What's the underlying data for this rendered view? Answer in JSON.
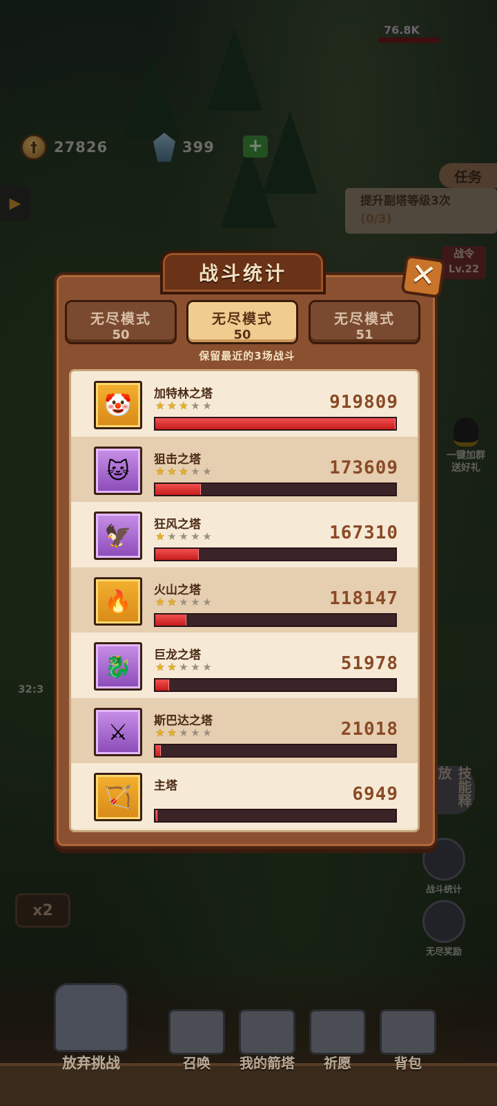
{
  "hud": {
    "gold": "27826",
    "gems": "399",
    "add_label": "+",
    "boss_hp": "76.8K",
    "quest_tab": "任务",
    "quest_text": "提升副塔等级3次",
    "quest_progress": "(0/3)",
    "battle_pass": "战令",
    "battle_pass_level": "Lv.22",
    "qq_group": "一键加群",
    "qq_gift": "送好礼",
    "stats_button": "战斗统计",
    "endless_reward": "无尽奖励",
    "skill_release": "技能释放",
    "speed": "x2",
    "timer": "32:3"
  },
  "bottom_nav": {
    "give_up": "放弃挑战",
    "summon": "召唤",
    "my_towers": "我的箭塔",
    "pray": "祈愿",
    "backpack": "背包"
  },
  "modal": {
    "title": "战斗统计",
    "close": "✕",
    "keep_note": "保留最近的3场战斗",
    "modes": [
      {
        "name": "无尽模式",
        "wave": "50",
        "active": false
      },
      {
        "name": "无尽模式",
        "wave": "50",
        "active": true
      },
      {
        "name": "无尽模式",
        "wave": "51",
        "active": false
      }
    ],
    "towers": [
      {
        "name": "加特林之塔",
        "damage": 919809,
        "stars": 3,
        "frame": "gold",
        "icon": "gatling-tower-icon",
        "glyph": "🤡"
      },
      {
        "name": "狙击之塔",
        "damage": 173609,
        "stars": 3,
        "frame": "purple",
        "icon": "sniper-tower-icon",
        "glyph": "🐱"
      },
      {
        "name": "狂风之塔",
        "damage": 167310,
        "stars": 1,
        "frame": "purple",
        "icon": "gale-tower-icon",
        "glyph": "🦅"
      },
      {
        "name": "火山之塔",
        "damage": 118147,
        "stars": 2,
        "frame": "gold",
        "icon": "volcano-tower-icon",
        "glyph": "🔥"
      },
      {
        "name": "巨龙之塔",
        "damage": 51978,
        "stars": 2,
        "frame": "purple",
        "icon": "dragon-tower-icon",
        "glyph": "🐉"
      },
      {
        "name": "斯巴达之塔",
        "damage": 21018,
        "stars": 2,
        "frame": "purple",
        "icon": "sparta-tower-icon",
        "glyph": "⚔"
      },
      {
        "name": "主塔",
        "damage": 6949,
        "stars": 0,
        "frame": "gold",
        "icon": "main-tower-icon",
        "glyph": "🏹"
      }
    ]
  }
}
